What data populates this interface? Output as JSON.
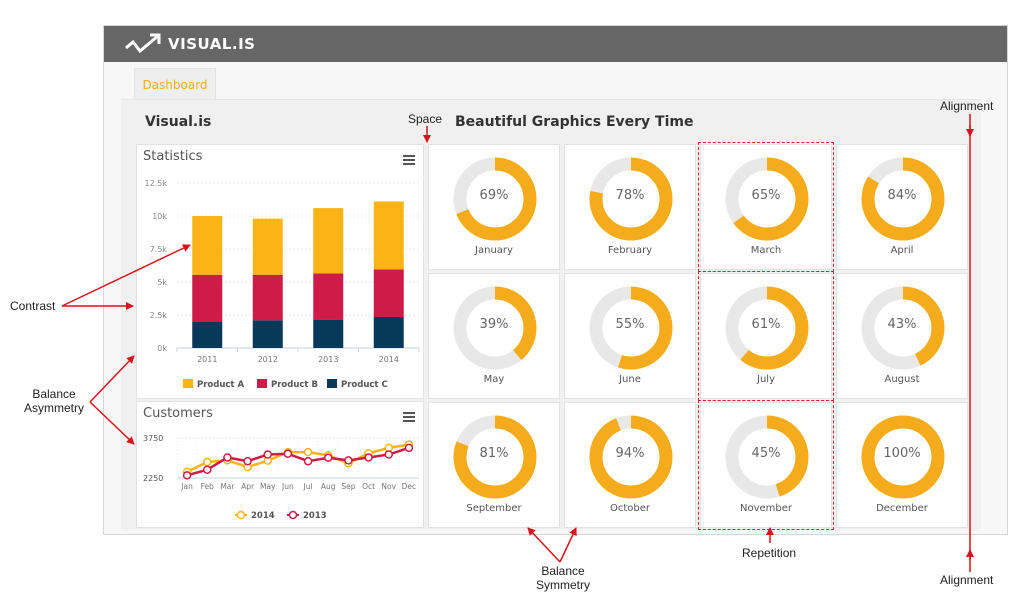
{
  "app": {
    "logo_text": "VISUAL.IS"
  },
  "tabs": [
    {
      "label": "Dashboard",
      "active": true
    }
  ],
  "panel": {
    "title": "Visual.is",
    "subtitle": "Beautiful Graphics Every Time"
  },
  "colors": {
    "accent": "#f5ac1c",
    "product_a": "#fbb415",
    "product_b": "#ce1b47",
    "product_c": "#08395a",
    "line_2014": "#fbb415",
    "line_2013": "#ce1b47",
    "donut_track": "#e8e8e8",
    "annotation": "#d9121b",
    "topbar": "#666666"
  },
  "statistics": {
    "title": "Statistics",
    "menu_icon": "hamburger-icon",
    "legend": [
      "Product A",
      "Product B",
      "Product C"
    ]
  },
  "customers": {
    "title": "Customers",
    "menu_icon": "hamburger-icon",
    "legend": [
      "2014",
      "2013"
    ]
  },
  "chart_data": [
    {
      "type": "bar",
      "stacked": true,
      "title": "Statistics",
      "categories": [
        "2011",
        "2012",
        "2013",
        "2014"
      ],
      "series": [
        {
          "name": "Product C",
          "values": [
            2000,
            2100,
            2150,
            2350
          ]
        },
        {
          "name": "Product B",
          "values": [
            3550,
            3450,
            3500,
            3600
          ]
        },
        {
          "name": "Product A",
          "values": [
            4450,
            4250,
            4950,
            5150
          ]
        }
      ],
      "yticks": [
        "0k",
        "2.5k",
        "5k",
        "7.5k",
        "10k",
        "12.5k"
      ],
      "ylim": [
        0,
        12500
      ],
      "grid": true,
      "legend": "bottom"
    },
    {
      "type": "line",
      "title": "Customers",
      "categories": [
        "Jan",
        "Feb",
        "Mar",
        "Apr",
        "May",
        "Jun",
        "Jul",
        "Aug",
        "Sep",
        "Oct",
        "Nov",
        "Dec"
      ],
      "series": [
        {
          "name": "2014",
          "values": [
            2480,
            2850,
            2910,
            2660,
            2900,
            3220,
            3220,
            3100,
            2800,
            3180,
            3380,
            3500
          ]
        },
        {
          "name": "2013",
          "values": [
            2350,
            2560,
            3020,
            2880,
            3130,
            3160,
            2880,
            3010,
            2910,
            3020,
            3130,
            3380
          ]
        }
      ],
      "yticks": [
        "2250",
        "3750"
      ],
      "ylim": [
        2100,
        3850
      ],
      "grid": true,
      "legend": "bottom"
    },
    {
      "type": "pie",
      "variant": "donut",
      "categories": [
        "January",
        "February",
        "March",
        "April",
        "May",
        "June",
        "July",
        "August",
        "September",
        "October",
        "November",
        "December"
      ],
      "values": [
        69,
        78,
        65,
        84,
        39,
        55,
        61,
        43,
        81,
        94,
        45,
        100
      ],
      "labels": [
        "69%",
        "78%",
        "65%",
        "84%",
        "39%",
        "55%",
        "61%",
        "43%",
        "81%",
        "94%",
        "45%",
        "100%"
      ]
    }
  ],
  "donuts": [
    {
      "month": "January",
      "pct": "69%"
    },
    {
      "month": "February",
      "pct": "78%"
    },
    {
      "month": "March",
      "pct": "65%"
    },
    {
      "month": "April",
      "pct": "84%"
    },
    {
      "month": "May",
      "pct": "39%"
    },
    {
      "month": "June",
      "pct": "55%"
    },
    {
      "month": "July",
      "pct": "61%"
    },
    {
      "month": "August",
      "pct": "43%"
    },
    {
      "month": "September",
      "pct": "81%"
    },
    {
      "month": "October",
      "pct": "94%"
    },
    {
      "month": "November",
      "pct": "45%"
    },
    {
      "month": "December",
      "pct": "100%"
    }
  ],
  "annotations": {
    "space": "Space",
    "alignment_top": "Alignment",
    "alignment_bottom": "Alignment",
    "contrast": "Contrast",
    "balance_asymmetry_1": "Balance",
    "balance_asymmetry_2": "Asymmetry",
    "balance_symmetry_1": "Balance",
    "balance_symmetry_2": "Symmetry",
    "repetition": "Repetition"
  }
}
